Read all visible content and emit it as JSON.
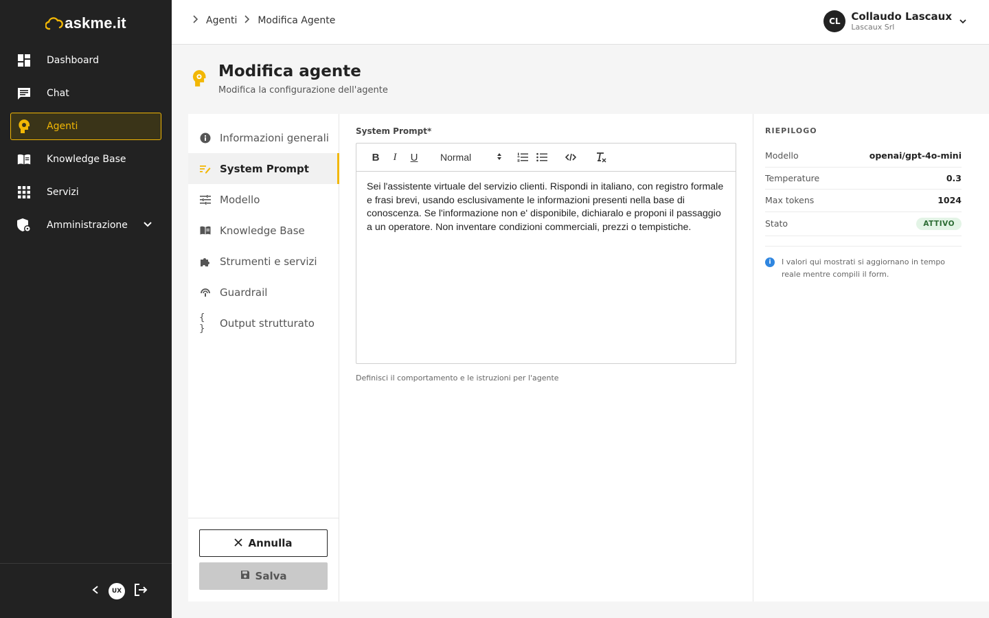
{
  "app": {
    "logo_text": "askme.it"
  },
  "colors": {
    "accent": "#f2b705",
    "sidebar_bg": "#222222",
    "info": "#2f86e0",
    "success_bg": "#e3f4e6"
  },
  "sidebar": {
    "items": [
      {
        "label": "Dashboard",
        "icon": "dashboard-icon"
      },
      {
        "label": "Chat",
        "icon": "chat-icon"
      },
      {
        "label": "Agenti",
        "icon": "agent-icon",
        "active": true
      },
      {
        "label": "Knowledge Base",
        "icon": "book-icon"
      },
      {
        "label": "Servizi",
        "icon": "grid-icon"
      },
      {
        "label": "Amministrazione",
        "icon": "admin-shield-icon",
        "expandable": true
      }
    ],
    "footer": {
      "badge": "UX"
    }
  },
  "topbar": {
    "breadcrumb": [
      "Agenti",
      "Modifica Agente"
    ],
    "user": {
      "initials": "CL",
      "name": "Collaudo Lascaux",
      "company": "Lascaux Srl"
    }
  },
  "header": {
    "title": "Modifica agente",
    "subtitle": "Modifica la configurazione dell'agente"
  },
  "tabs": [
    {
      "label": "Informazioni generali",
      "icon": "info-icon"
    },
    {
      "label": "System Prompt",
      "icon": "edit-note-icon",
      "active": true
    },
    {
      "label": "Modello",
      "icon": "tune-icon"
    },
    {
      "label": "Knowledge Base",
      "icon": "book-icon"
    },
    {
      "label": "Strumenti e servizi",
      "icon": "puzzle-icon"
    },
    {
      "label": "Guardrail",
      "icon": "guardrail-icon"
    },
    {
      "label": "Output strutturato",
      "icon": "braces-icon"
    }
  ],
  "actions": {
    "cancel": "Annulla",
    "save": "Salva"
  },
  "editor": {
    "label": "System Prompt*",
    "format": "Normal",
    "content": "Sei l'assistente virtuale del servizio clienti. Rispondi in italiano, con registro formale e frasi brevi, usando esclusivamente le informazioni presenti nella base di conoscenza. Se l'informazione non e' disponibile, dichiaralo e proponi il passaggio a un operatore. Non inventare condizioni commerciali, prezzi o tempistiche.",
    "helper": "Definisci il comportamento e le istruzioni per l'agente"
  },
  "summary": {
    "title": "RIEPILOGO",
    "rows": [
      {
        "key": "Modello",
        "value": "openai/gpt-4o-mini"
      },
      {
        "key": "Temperature",
        "value": "0.3"
      },
      {
        "key": "Max tokens",
        "value": "1024"
      },
      {
        "key": "Stato",
        "value": "ATTIVO"
      }
    ],
    "note": "I valori qui mostrati si aggiornano in tempo reale mentre compili il form."
  }
}
